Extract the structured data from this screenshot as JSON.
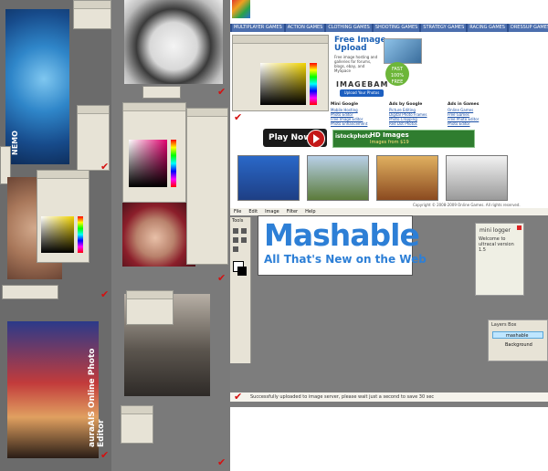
{
  "site": {
    "nav": [
      "MULTIPLAYER GAMES",
      "ACTION GAMES",
      "CLOTHING GAMES",
      "SHOOTING GAMES",
      "STRATEGY GAMES",
      "RACING GAMES",
      "DRESSUP GAMES"
    ],
    "upload": {
      "title_line1": "Free Image",
      "title_line2": "Upload",
      "description": "Free image hosting and galleries for forums, blogs, ebay, and MySpace",
      "brand": "IMAGEBAM",
      "button": "Upload Your Photos",
      "badge_line1": "FAST",
      "badge_line2": "100%",
      "badge_line3": "FREE"
    },
    "links": [
      {
        "header": "Mini Google",
        "items": [
          "Mobile Hosting",
          "Photo Editor",
          "Free Image Editor",
          "Photo Enhancement"
        ]
      },
      {
        "header": "Ads by Google",
        "items": [
          "Picture Editing",
          "Digital Photo Frames",
          "Photo Cropping",
          "Red Dot Photos"
        ]
      },
      {
        "header": "Ads in Games",
        "items": [
          "Online Games",
          "Free Games",
          "Free Photo Editor",
          "Photo Editor"
        ]
      }
    ],
    "play_now": "Play Now!",
    "hd_bar": {
      "logo": "istockphoto",
      "title": "HD Images",
      "sub": "Images from $19"
    },
    "copyright": "Copyright © 2008-2009 Online Games. All rights reserved."
  },
  "editor": {
    "menus": [
      "File",
      "Edit",
      "Image",
      "Filter",
      "Help"
    ],
    "tools_label": "Tools",
    "canvas": {
      "title": "Mashable",
      "subtitle": "All That's New on the Web"
    },
    "note": {
      "title": "mini logger",
      "body": "Welcome to ultracal version 1.5"
    },
    "layers": {
      "title": "Layers Box",
      "items": [
        "mashable",
        "Background"
      ]
    },
    "status": "Successfully uploaded to image server, please wait just a second to save 30 sec"
  },
  "left_editor": {
    "vertical_label": "auraAIS Online Photo Editor",
    "movie": "NEMO"
  },
  "colors": {
    "accent_blue": "#2d7fd6",
    "nav_blue": "#2d4f8f",
    "check_red": "#d41010",
    "panel_beige": "#e7e3d6"
  }
}
